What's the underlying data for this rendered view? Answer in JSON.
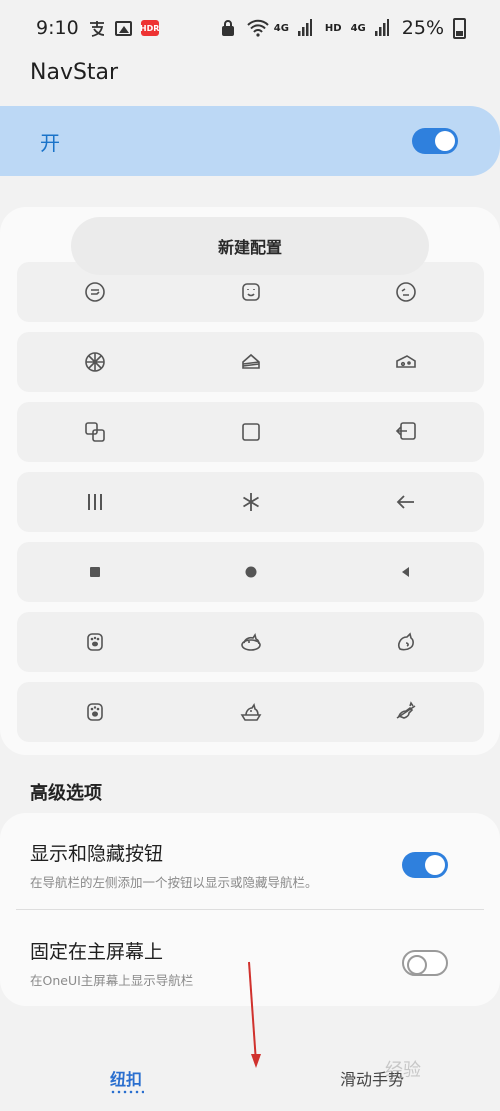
{
  "status_bar": {
    "time": "9:10",
    "network_4g_a": "4G",
    "hd_label": "HD",
    "network_4g_b": "4G",
    "battery": "25%"
  },
  "app_title": "NavStar",
  "master_switch": {
    "label": "开",
    "state": "on"
  },
  "new_config_label": "新建配置",
  "icon_rows": [
    [
      "face-swirl-icon",
      "face-box-icon",
      "face-tilt-icon"
    ],
    [
      "pizza-icon",
      "cake-slice-icon",
      "cheese-icon"
    ],
    [
      "recents-overlap-icon",
      "home-square-icon",
      "back-box-icon"
    ],
    [
      "recents-bars-icon",
      "home-asterisk-icon",
      "back-arrow-icon"
    ],
    [
      "recents-filled-square-icon",
      "home-filled-circle-icon",
      "back-filled-triangle-icon"
    ],
    [
      "paw-cup-icon",
      "sleeping-cat-icon",
      "cat-curl-icon"
    ],
    [
      "paw-cup-alt-icon",
      "cat-basket-icon",
      "cat-stretch-icon"
    ]
  ],
  "advanced": {
    "title": "高级选项",
    "settings": [
      {
        "title": "显示和隐藏按钮",
        "desc": "在导航栏的左侧添加一个按钮以显示或隐藏导航栏。",
        "state": "on"
      },
      {
        "title": "固定在主屏幕上",
        "desc": "在OneUI主屏幕上显示导航栏",
        "state": "off"
      }
    ]
  },
  "bottom_nav": {
    "tabs": [
      {
        "label": "纽扣",
        "active": true
      },
      {
        "label": "滑动手势",
        "active": false
      }
    ]
  },
  "watermark": "经验",
  "colors": {
    "accent": "#2f80dd",
    "master_bg": "#bcd8f5",
    "annotation": "#d0312d"
  }
}
